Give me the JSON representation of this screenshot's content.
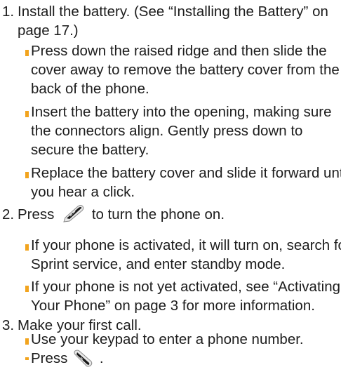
{
  "steps": [
    {
      "number": "1.",
      "lines": [
        "Install the battery. (See “Installing the Battery” on",
        "page 17.)"
      ],
      "bullets": [
        {
          "lines": [
            "Press down the raised ridge and then slide the",
            "cover away to remove the battery cover from the",
            "back of the phone."
          ]
        },
        {
          "lines": [
            "Insert the battery into the opening, making sure",
            "the connectors align. Gently press down to",
            "secure the battery."
          ]
        },
        {
          "lines": [
            "Replace the battery cover and slide it forward until",
            "you hear a click."
          ]
        }
      ]
    },
    {
      "number": "2.",
      "before_icon": "Press",
      "icon": "end-power-key-icon",
      "after_icon": "to turn the phone on.",
      "bullets": [
        {
          "lines": [
            "If your phone is activated, it will turn on, search for",
            "Sprint service, and enter standby mode."
          ]
        },
        {
          "lines": [
            "If your phone is not yet activated, see “Activating",
            "Your Phone” on page 3 for more information."
          ]
        }
      ]
    },
    {
      "number": "3.",
      "lines": [
        "Make your first call."
      ],
      "bullets": [
        {
          "lines": [
            "Use your keypad to enter a phone number."
          ]
        },
        {
          "before_icon": "Press",
          "icon": "talk-key-icon",
          "after_icon": "."
        }
      ]
    }
  ],
  "colors": {
    "text": "#1d1d1d",
    "bullet": "#f2a41e",
    "key": "#e8e8e8"
  }
}
